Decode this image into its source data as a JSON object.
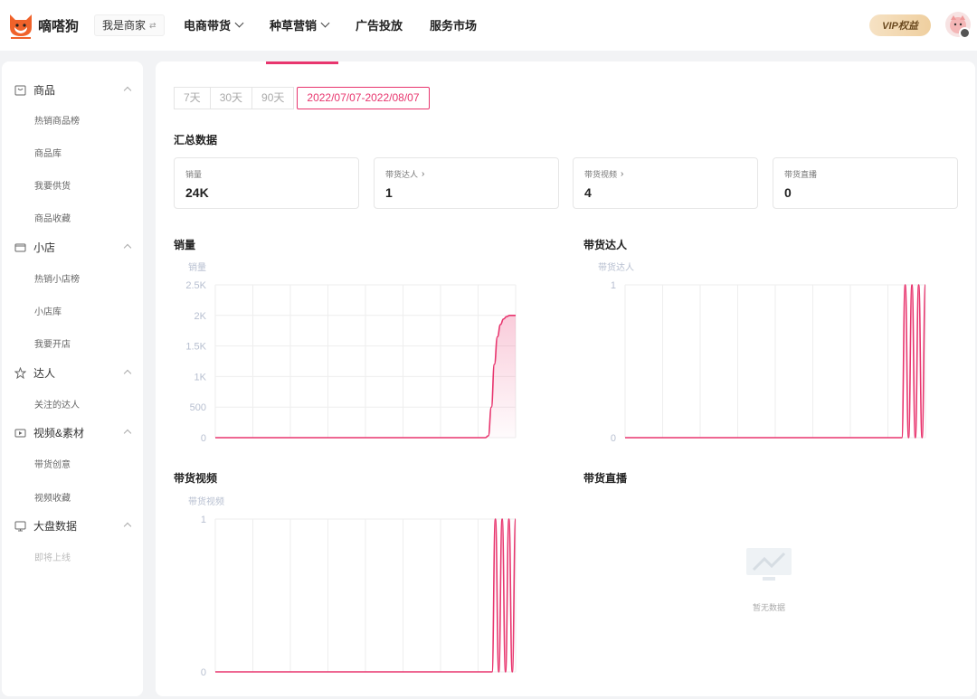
{
  "header": {
    "logo_text": "嘀嗒狗",
    "role": "我是商家",
    "nav": [
      {
        "label": "电商带货",
        "has_dropdown": true
      },
      {
        "label": "种草营销",
        "has_dropdown": true
      },
      {
        "label": "广告投放",
        "has_dropdown": false
      },
      {
        "label": "服务市场",
        "has_dropdown": false
      }
    ],
    "vip_label": "VIP权益"
  },
  "sidebar": {
    "groups": [
      {
        "label": "商品",
        "icon": "bag-icon",
        "items": [
          "热销商品榜",
          "商品库",
          "我要供货",
          "商品收藏"
        ]
      },
      {
        "label": "小店",
        "icon": "store-icon",
        "items": [
          "热销小店榜",
          "小店库",
          "我要开店"
        ]
      },
      {
        "label": "达人",
        "icon": "star-icon",
        "items": [
          "关注的达人"
        ]
      },
      {
        "label": "视频&素材",
        "icon": "video-icon",
        "items": [
          "带货创意",
          "视频收藏"
        ]
      },
      {
        "label": "大盘数据",
        "icon": "monitor-icon",
        "items": [
          "即将上线"
        ]
      }
    ]
  },
  "main": {
    "date_ranges": [
      "7天",
      "30天",
      "90天"
    ],
    "active_range": "2022/07/07-2022/08/07",
    "summary_title": "汇总数据",
    "stats": [
      {
        "label": "销量",
        "value": "24K",
        "has_arrow": false
      },
      {
        "label": "带货达人",
        "value": "1",
        "has_arrow": true
      },
      {
        "label": "带货视频",
        "value": "4",
        "has_arrow": true
      },
      {
        "label": "带货直播",
        "value": "0",
        "has_arrow": false
      }
    ],
    "empty_text": "暂无数据"
  },
  "colors": {
    "accent": "#e8356e",
    "vip_bg": "#f3dab4"
  },
  "chart_data": [
    {
      "type": "area",
      "title": "销量",
      "ylabel": "销量",
      "yticks": [
        "2.5K",
        "2K",
        "1.5K",
        "1K",
        "500",
        "0"
      ],
      "ylim": [
        0,
        2500
      ],
      "values": [
        0,
        0,
        0,
        0,
        0,
        0,
        0,
        0,
        0,
        0,
        0,
        0,
        0,
        0,
        0,
        0,
        0,
        0,
        0,
        0,
        0,
        0,
        0,
        0,
        0,
        0,
        0,
        0,
        0,
        0,
        0,
        0,
        0,
        0,
        0,
        0,
        0,
        0,
        0,
        0,
        0,
        0,
        0,
        0,
        0,
        0,
        0,
        0,
        0,
        0,
        0,
        0,
        0,
        0,
        0,
        0,
        0,
        0,
        0,
        0,
        0,
        0,
        0,
        0,
        0,
        0,
        0,
        0,
        0,
        0,
        0,
        0,
        0,
        0,
        0,
        0,
        0,
        0,
        0,
        0,
        0,
        0,
        0,
        0,
        0,
        0,
        0,
        0,
        0,
        0,
        30,
        500,
        1200,
        1650,
        1850,
        1940,
        1980,
        2000,
        2000,
        2000
      ]
    },
    {
      "type": "line",
      "title": "带货达人",
      "ylabel": "带货达人",
      "yticks": [
        "1",
        "0"
      ],
      "ylim": [
        0,
        1
      ],
      "values": [
        0,
        0,
        0,
        0,
        0,
        0,
        0,
        0,
        0,
        0,
        0,
        0,
        0,
        0,
        0,
        0,
        0,
        0,
        0,
        0,
        0,
        0,
        0,
        0,
        0,
        0,
        0,
        0,
        0,
        0,
        0,
        0,
        0,
        0,
        0,
        0,
        0,
        0,
        0,
        0,
        0,
        0,
        0,
        0,
        0,
        0,
        0,
        0,
        0,
        0,
        0,
        0,
        0,
        0,
        0,
        0,
        0,
        0,
        0,
        0,
        0,
        0,
        0,
        0,
        0,
        0,
        0,
        0,
        0,
        0,
        0,
        0,
        0,
        0,
        0,
        0,
        0,
        0,
        0,
        0,
        0,
        0,
        0,
        1,
        0,
        1,
        0,
        1,
        0,
        1
      ]
    },
    {
      "type": "line",
      "title": "带货视频",
      "ylabel": "带货视频",
      "yticks": [
        "1",
        "0"
      ],
      "ylim": [
        0,
        1
      ],
      "values": [
        0,
        0,
        0,
        0,
        0,
        0,
        0,
        0,
        0,
        0,
        0,
        0,
        0,
        0,
        0,
        0,
        0,
        0,
        0,
        0,
        0,
        0,
        0,
        0,
        0,
        0,
        0,
        0,
        0,
        0,
        0,
        0,
        0,
        0,
        0,
        0,
        0,
        0,
        0,
        0,
        0,
        0,
        0,
        0,
        0,
        0,
        0,
        0,
        0,
        0,
        0,
        0,
        0,
        0,
        0,
        0,
        0,
        0,
        0,
        0,
        0,
        0,
        0,
        0,
        0,
        0,
        0,
        0,
        0,
        0,
        0,
        0,
        0,
        0,
        0,
        0,
        0,
        0,
        0,
        0,
        0,
        0,
        0,
        1,
        0,
        1,
        0,
        1,
        0,
        1
      ]
    },
    {
      "type": "line",
      "title": "带货直播",
      "values": []
    }
  ]
}
